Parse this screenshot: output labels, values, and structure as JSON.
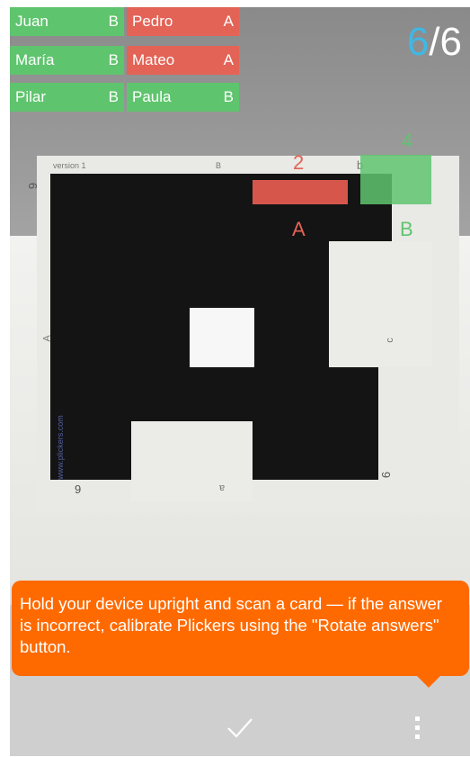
{
  "roster": [
    {
      "name": "Juan",
      "answer": "B",
      "status": "correct"
    },
    {
      "name": "Pedro",
      "answer": "A",
      "status": "incorrect"
    },
    {
      "name": "María",
      "answer": "B",
      "status": "correct"
    },
    {
      "name": "Mateo",
      "answer": "A",
      "status": "incorrect"
    },
    {
      "name": "Pilar",
      "answer": "B",
      "status": "correct"
    },
    {
      "name": "Paula",
      "answer": "B",
      "status": "correct"
    }
  ],
  "counter": {
    "current": "6",
    "total": "/6"
  },
  "answers": {
    "a": {
      "count": "2",
      "label": "A"
    },
    "b": {
      "count": "4",
      "label": "B"
    }
  },
  "card": {
    "version": "version 1",
    "top_label": "B",
    "top_right_label": "b",
    "left_label": "A",
    "right_label": "c",
    "bottom_label": "a",
    "number_top_left": "6",
    "number_bottom_left": "9",
    "number_bottom_right": "6",
    "website": "www.plickers.com"
  },
  "tooltip": {
    "text": "Hold your device upright and scan a card — if the answer is incorrect, calibrate Plickers using the \"Rotate answers\" button."
  },
  "colors": {
    "correct": "#5fc46e",
    "incorrect": "#e36356",
    "accent": "#3fb8e6",
    "tooltip": "#ff6a00"
  },
  "icons": {
    "confirm": "check-icon",
    "menu": "more-vertical-icon"
  }
}
